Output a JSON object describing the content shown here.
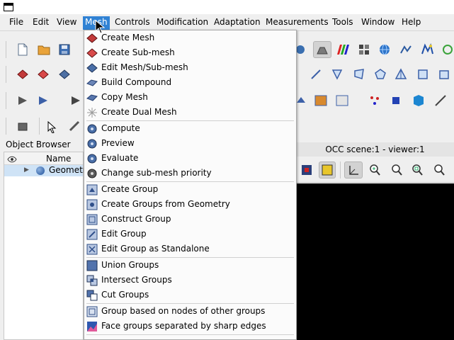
{
  "window": {
    "icon": "window-icon"
  },
  "menubar": {
    "items": [
      "File",
      "Edit",
      "View",
      "Mesh",
      "Controls",
      "Modification",
      "Adaptation",
      "Measurements",
      "Tools",
      "Window",
      "Help"
    ],
    "active": "Mesh"
  },
  "object_browser": {
    "title": "Object Browser",
    "column_name": "Name",
    "rows": [
      {
        "label": "Geometr"
      }
    ]
  },
  "viewer": {
    "title": "OCC scene:1 - viewer:1"
  },
  "mesh_menu": {
    "groups": [
      [
        {
          "label": "Create Mesh",
          "icon": "create-mesh-icon"
        },
        {
          "label": "Create Sub-mesh",
          "icon": "create-submesh-icon"
        },
        {
          "label": "Edit Mesh/Sub-mesh",
          "icon": "edit-mesh-icon"
        },
        {
          "label": "Build Compound",
          "icon": "build-compound-icon"
        },
        {
          "label": "Copy Mesh",
          "icon": "copy-mesh-icon"
        },
        {
          "label": "Create Dual Mesh",
          "icon": "dual-mesh-icon"
        }
      ],
      [
        {
          "label": "Compute",
          "icon": "compute-icon"
        },
        {
          "label": "Preview",
          "icon": "preview-icon"
        },
        {
          "label": "Evaluate",
          "icon": "evaluate-icon"
        },
        {
          "label": "Change sub-mesh priority",
          "icon": "submesh-priority-icon"
        }
      ],
      [
        {
          "label": "Create Group",
          "icon": "create-group-icon"
        },
        {
          "label": "Create Groups from Geometry",
          "icon": "groups-from-geometry-icon"
        },
        {
          "label": "Construct Group",
          "icon": "construct-group-icon"
        },
        {
          "label": "Edit Group",
          "icon": "edit-group-icon"
        },
        {
          "label": "Edit Group as Standalone",
          "icon": "edit-group-standalone-icon"
        }
      ],
      [
        {
          "label": "Union Groups",
          "icon": "union-groups-icon"
        },
        {
          "label": "Intersect Groups",
          "icon": "intersect-groups-icon"
        },
        {
          "label": "Cut Groups",
          "icon": "cut-groups-icon"
        }
      ],
      [
        {
          "label": "Group based on nodes of other groups",
          "icon": "group-nodes-icon"
        },
        {
          "label": "Face groups separated by sharp edges",
          "icon": "face-groups-icon"
        }
      ]
    ]
  }
}
